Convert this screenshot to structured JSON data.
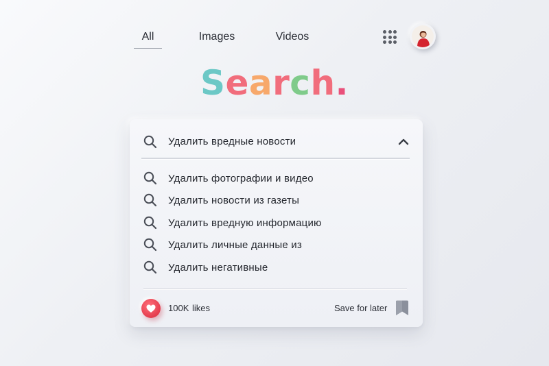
{
  "nav": {
    "tabs": [
      {
        "label": "All",
        "active": true
      },
      {
        "label": "Images",
        "active": false
      },
      {
        "label": "Videos",
        "active": false
      }
    ],
    "apps_icon": "apps-grid-icon",
    "avatar_icon": "user-avatar"
  },
  "logo": {
    "letters": [
      "S",
      "e",
      "a",
      "r",
      "c",
      "h",
      "."
    ],
    "colors": [
      "#6cc8c6",
      "#f16d7c",
      "#f7a86b",
      "#f16d7c",
      "#7fcb8a",
      "#f16d7c",
      "#e9507a"
    ]
  },
  "search": {
    "query": "Удалить вредные новости",
    "icon": "search-icon",
    "collapse_icon": "chevron-up-icon",
    "suggestions": [
      "Удалить фотографии и видео",
      "Удалить новости из газеты",
      "Удалить вредную информацию",
      "Удалить личные данные из",
      "Удалить негативные"
    ]
  },
  "footer": {
    "likes_count": "100K",
    "likes_label": "likes",
    "like_icon": "heart-icon",
    "save_label": "Save for later",
    "bookmark_icon": "bookmark-icon"
  },
  "colors": {
    "accent_red": "#e43d4e",
    "text": "#24272e",
    "bookmark": "#8b909c"
  }
}
